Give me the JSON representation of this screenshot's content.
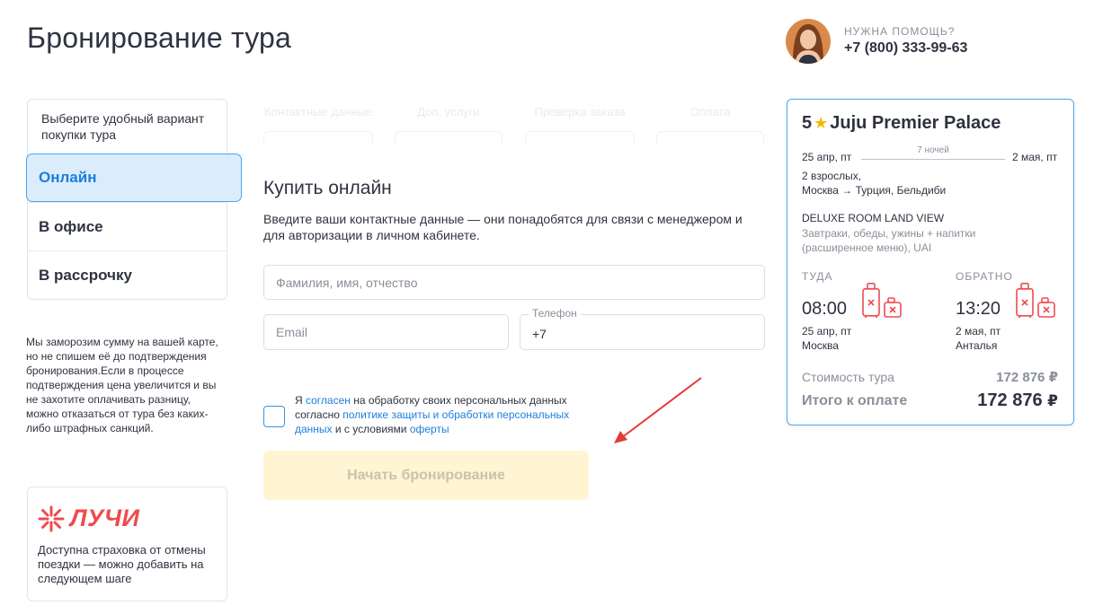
{
  "header": {
    "title": "Бронирование тура",
    "help_label": "НУЖНА ПОМОЩЬ?",
    "help_phone": "+7 (800) 333-99-63"
  },
  "options": {
    "hint": "Выберите удобный вариант покупки тура",
    "items": [
      {
        "label": "Онлайн",
        "active": true
      },
      {
        "label": "В офисе",
        "active": false
      },
      {
        "label": "В рассрочку",
        "active": false
      }
    ]
  },
  "freeze_note": "Мы заморозим сумму на вашей карте, но не спишем её до подтверждения бронирования.Если в процессе подтверждения цена увеличится и вы не захотите оплачивать разницу, можно отказаться от тура без каких-либо штрафных санкций.",
  "insurance": {
    "logo_text": "ЛУЧИ",
    "text": "Доступна страховка от отмены поездки — можно добавить на следующем шаге"
  },
  "steps": [
    "Контактные данные",
    "Доп. услуги",
    "Проверка заказа",
    "Оплата"
  ],
  "form": {
    "title": "Купить онлайн",
    "description": "Введите ваши контактные данные — они понадобятся для связи с менеджером и для авторизации в личном кабинете.",
    "name_placeholder": "Фамилия, имя, отчество",
    "email_placeholder": "Email",
    "phone_label": "Телефон",
    "phone_value": "+7",
    "consent": {
      "p1": "Я ",
      "link1": "согласен",
      "p2": " на обработку своих персональных данных согласно ",
      "link2": "политике защиты и обработки персональных данных",
      "p3": " и с условиями ",
      "link3": "оферты"
    },
    "submit_label": "Начать бронирование"
  },
  "summary": {
    "stars": "5",
    "hotel": "Juju Premier Palace",
    "date_from": "25 апр, пт",
    "nights": "7 ночей",
    "date_to": "2 мая, пт",
    "guests": "2 взрослых,",
    "route": "Москва → Турция, Бельдиби",
    "room": "DELUXE ROOM LAND VIEW",
    "meals": "Завтраки, обеды, ужины + напитки (расширенное меню), UAI",
    "outbound": {
      "label": "ТУДА",
      "time": "08:00",
      "date": "25 апр, пт",
      "city": "Москва"
    },
    "return": {
      "label": "ОБРАТНО",
      "time": "13:20",
      "date": "2 мая, пт",
      "city": "Анталья"
    },
    "cost_label": "Стоимость тура",
    "cost_value": "172 876",
    "total_label": "Итого к оплате",
    "total_value": "172 876",
    "currency": "₽"
  },
  "colors": {
    "accent": "#1c7fdb",
    "active_bg": "#dbedfd",
    "button_disabled_bg": "#fff5d2",
    "luggage_red": "#ef4a4e",
    "arrow_red": "#e53935"
  }
}
